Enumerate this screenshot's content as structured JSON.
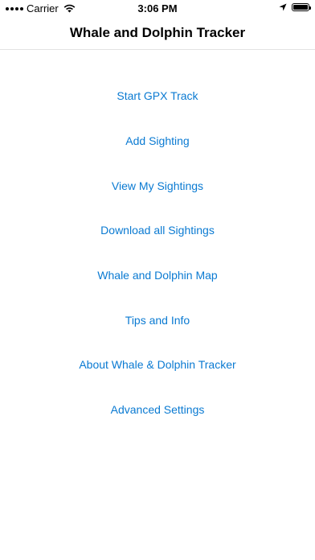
{
  "status_bar": {
    "carrier": "Carrier",
    "time": "3:06 PM",
    "battery_level": 1.0,
    "icons": [
      "signal-dots",
      "wifi-icon",
      "location-arrow-icon",
      "battery-icon"
    ]
  },
  "nav": {
    "title": "Whale and Dolphin Tracker"
  },
  "menu": {
    "items": [
      {
        "label": "Start GPX Track"
      },
      {
        "label": "Add Sighting"
      },
      {
        "label": "View My Sightings"
      },
      {
        "label": "Download all Sightings"
      },
      {
        "label": "Whale and Dolphin Map"
      },
      {
        "label": "Tips and Info"
      },
      {
        "label": "About Whale & Dolphin Tracker"
      },
      {
        "label": "Advanced Settings"
      }
    ]
  },
  "colors": {
    "link": "#0a7ad2",
    "background": "#ffffff",
    "divider": "#e3e3e3"
  }
}
